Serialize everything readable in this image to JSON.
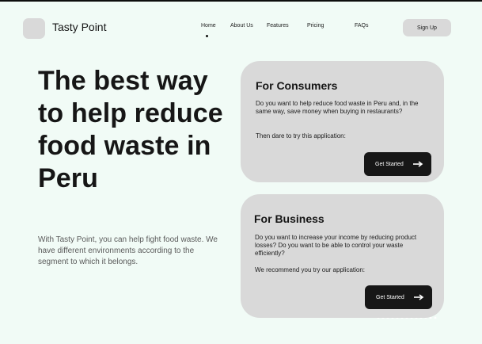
{
  "header": {
    "brand": "Tasty Point",
    "nav": [
      {
        "label": "Home"
      },
      {
        "label": "About Us"
      },
      {
        "label": "Features"
      },
      {
        "label": "Pricing"
      },
      {
        "label": "FAQs"
      }
    ],
    "signup_label": "Sign Up"
  },
  "hero": {
    "title": "The best way to help reduce food waste in Peru",
    "description": "With Tasty Point, you can help fight food waste. We have different environments according to the segment to which it belongs."
  },
  "cards": {
    "consumers": {
      "title": "For Consumers",
      "text": "Do you want to help reduce food waste in Peru and, in the same way, save money when buying in restaurants?",
      "cta_text": "Then dare to try this application:",
      "button_label": "Get Started"
    },
    "business": {
      "title": "For Business",
      "text": "Do you want to increase your income by reducing product losses? Do you want to be able to control your waste efficiently?",
      "cta_text": "We recommend you try our application:",
      "button_label": "Get Started"
    }
  },
  "colors": {
    "background": "#f1fbf6",
    "card": "#d9d9d9",
    "button": "#171717",
    "accent_text": "#161616"
  },
  "icons": {
    "logo": "logo-placeholder",
    "active_indicator": "dot",
    "button_arrow": "arrow-right-icon"
  }
}
